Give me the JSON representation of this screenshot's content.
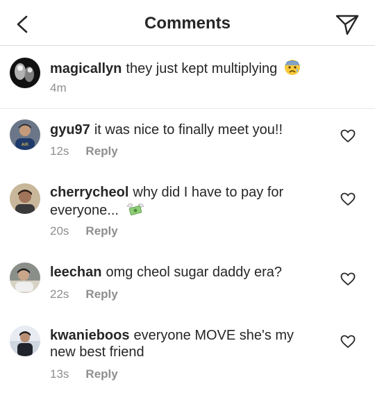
{
  "header": {
    "title": "Comments",
    "back_icon": "chevron-left-icon",
    "send_icon": "paper-plane-icon"
  },
  "caption": {
    "username": "magicallyn",
    "text": "they just kept multiplying",
    "time": "4m"
  },
  "reply_label": "Reply",
  "comments": [
    {
      "username": "gyu97",
      "text": "it was nice to finally meet you!!",
      "time": "12s"
    },
    {
      "username": "cherrycheol",
      "text_line1": "why did I have to pay for",
      "text_line2": "everyone...",
      "time": "20s"
    },
    {
      "username": "leechan",
      "text": "omg cheol sugar daddy era?",
      "time": "22s"
    },
    {
      "username": "kwanieboos",
      "text_line1": "everyone MOVE she's my",
      "text_line2": "new best friend",
      "time": "13s"
    }
  ]
}
